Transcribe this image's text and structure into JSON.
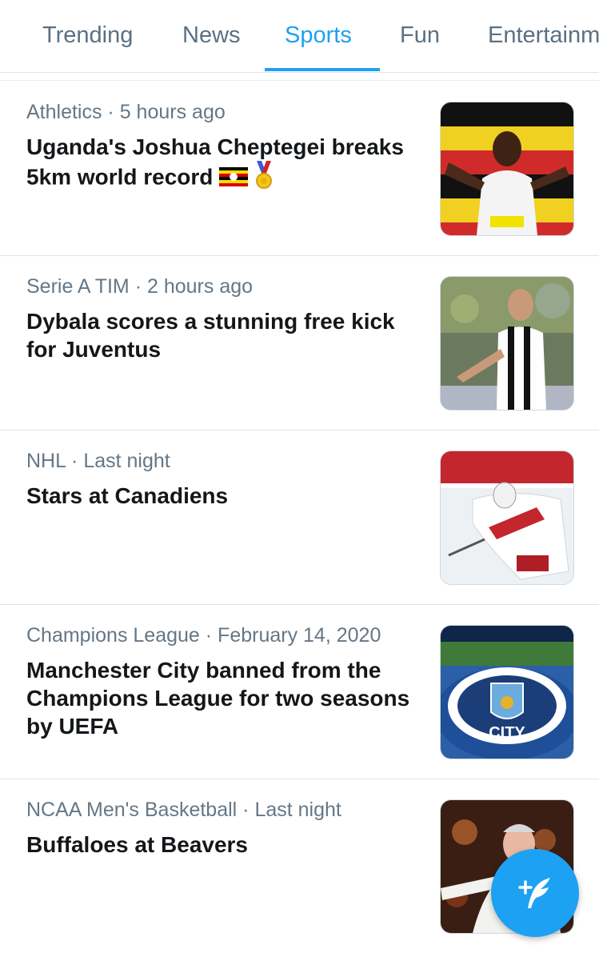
{
  "tabs": [
    {
      "label": "Trending",
      "active": false
    },
    {
      "label": "News",
      "active": false
    },
    {
      "label": "Sports",
      "active": true
    },
    {
      "label": "Fun",
      "active": false
    },
    {
      "label": "Entertainm",
      "active": false
    }
  ],
  "items": [
    {
      "category": "Athletics",
      "time": "5 hours ago",
      "headline": "Uganda's Joshua Cheptegei breaks 5km world record",
      "emoji": [
        "uganda-flag-icon",
        "medal-icon"
      ]
    },
    {
      "category": "Serie A TIM",
      "time": "2 hours ago",
      "headline": "Dybala scores a stunning free kick for Juventus"
    },
    {
      "category": "NHL",
      "time": "Last night",
      "headline": "Stars at Canadiens"
    },
    {
      "category": "Champions League",
      "time": "February 14, 2020",
      "headline": "Manchester City banned from the Champions League for two seasons by UEFA",
      "thumb_text": "CITY"
    },
    {
      "category": "NCAA Men's Basketball",
      "time": "Last night",
      "headline": "Buffaloes at Beavers"
    }
  ],
  "fab": {
    "icon": "compose-tweet-icon"
  },
  "colors": {
    "accent": "#1da1f2",
    "meta": "#657786",
    "tab_inactive": "#5b7083",
    "divider": "#dfe3e6"
  }
}
